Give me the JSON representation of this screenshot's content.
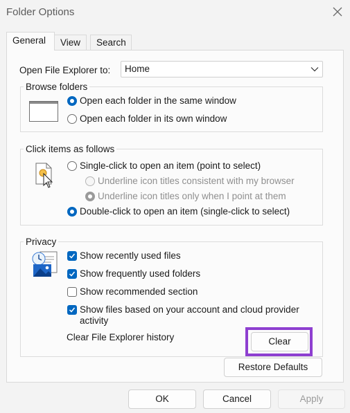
{
  "window": {
    "title": "Folder Options"
  },
  "tabs": [
    {
      "label": "General",
      "active": true
    },
    {
      "label": "View",
      "active": false
    },
    {
      "label": "Search",
      "active": false
    }
  ],
  "open_to": {
    "label": "Open File Explorer to:",
    "value": "Home"
  },
  "browse": {
    "title": "Browse folders",
    "options": [
      {
        "label": "Open each folder in the same window",
        "selected": true
      },
      {
        "label": "Open each folder in its own window",
        "selected": false
      }
    ]
  },
  "click_items": {
    "title": "Click items as follows",
    "single": "Single-click to open an item (point to select)",
    "sub_options": [
      "Underline icon titles consistent with my browser",
      "Underline icon titles only when I point at them"
    ],
    "double": "Double-click to open an item (single-click to select)"
  },
  "privacy": {
    "title": "Privacy",
    "items": [
      {
        "label": "Show recently used files",
        "checked": true
      },
      {
        "label": "Show frequently used folders",
        "checked": true
      },
      {
        "label": "Show recommended section",
        "checked": false
      },
      {
        "label_line1": "Show files based on your account and cloud provider",
        "label_line2": "activity",
        "checked": true
      }
    ],
    "history_label": "Clear File Explorer history",
    "clear_label": "Clear"
  },
  "restore_label": "Restore Defaults",
  "footer": {
    "ok": "OK",
    "cancel": "Cancel",
    "apply": "Apply"
  },
  "colors": {
    "accent": "#0067c0",
    "highlight": "#8e3fd0"
  }
}
